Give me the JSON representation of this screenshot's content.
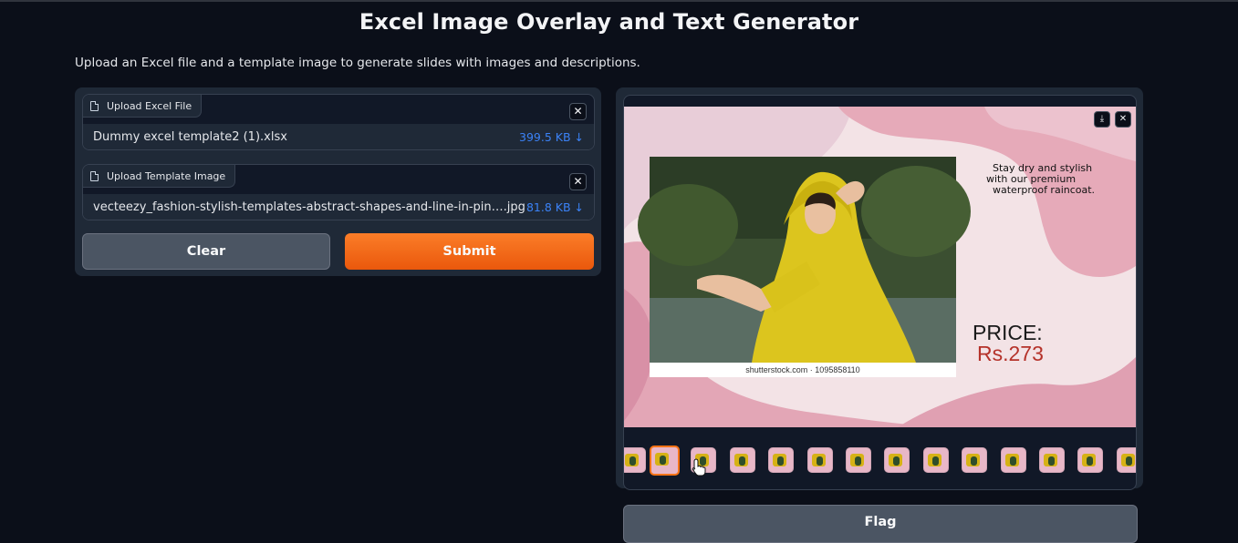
{
  "app": {
    "title": "Excel Image Overlay and Text Generator",
    "description": "Upload an Excel file and a template image to generate slides with images and descriptions."
  },
  "uploads": {
    "excel": {
      "label": "Upload Excel File",
      "file_name": "Dummy excel template2 (1).xlsx",
      "file_size": "399.5 KB ↓"
    },
    "template": {
      "label": "Upload Template Image",
      "file_name": "vecteezy_fashion-stylish-templates-abstract-shapes-and-line-in-pin….jpg",
      "file_size": "81.8 KB ↓"
    },
    "close_glyph": "✕"
  },
  "buttons": {
    "clear": "Clear",
    "submit": "Submit",
    "flag": "Flag"
  },
  "gallery": {
    "download_glyph": "⤓",
    "close_glyph": "✕",
    "slide": {
      "watermark": "shutterstock.com · 1095858110",
      "tagline": [
        "Stay dry and stylish",
        "with our premium",
        "waterproof raincoat."
      ],
      "price_label": "PRICE:",
      "price_value": "Rs.273"
    },
    "thumbnail_count": 14,
    "selected_index": 1
  },
  "colors": {
    "background": "#0b0f19",
    "panel": "#1f2937",
    "accent": "#f97316",
    "file_size_link": "#3b82f6",
    "price_value": "#b5322a"
  }
}
